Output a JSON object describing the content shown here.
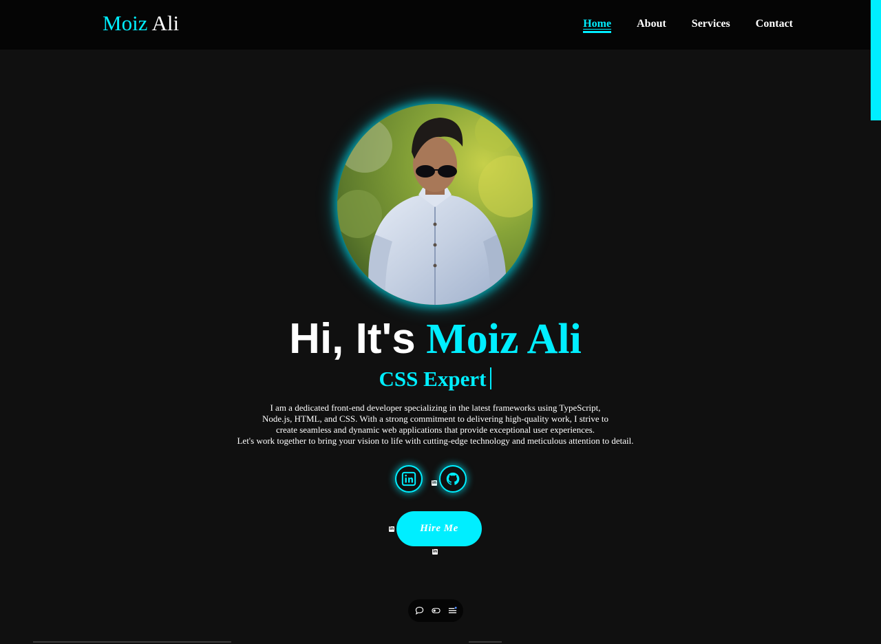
{
  "brand": {
    "first": "Moiz",
    "last": "Ali"
  },
  "nav": {
    "items": [
      {
        "label": "Home",
        "active": true
      },
      {
        "label": "About",
        "active": false
      },
      {
        "label": "Services",
        "active": false
      },
      {
        "label": "Contact",
        "active": false
      }
    ]
  },
  "hero": {
    "greeting": "Hi, It's",
    "name": "Moiz Ali",
    "role": "CSS Expert",
    "bio_lines": [
      "I am a dedicated front-end developer specializing in the latest frameworks using TypeScript,",
      "Node.js, HTML, and CSS. With a strong commitment to delivering high-quality work, I strive to",
      "create seamless and dynamic web applications that provide exceptional user experiences.",
      "Let's work together to bring your vision to life with cutting-edge technology and meticulous attention to detail."
    ],
    "hire_label": "Hire Me"
  },
  "social": {
    "icons": [
      "linkedin-icon",
      "github-icon"
    ]
  },
  "toolbar": {
    "icons": [
      "comment-icon",
      "toggle-icon",
      "menu-icon"
    ]
  },
  "colors": {
    "accent": "#00eeff",
    "background": "#101010",
    "navbar": "#050505",
    "text": "#ffffff"
  }
}
